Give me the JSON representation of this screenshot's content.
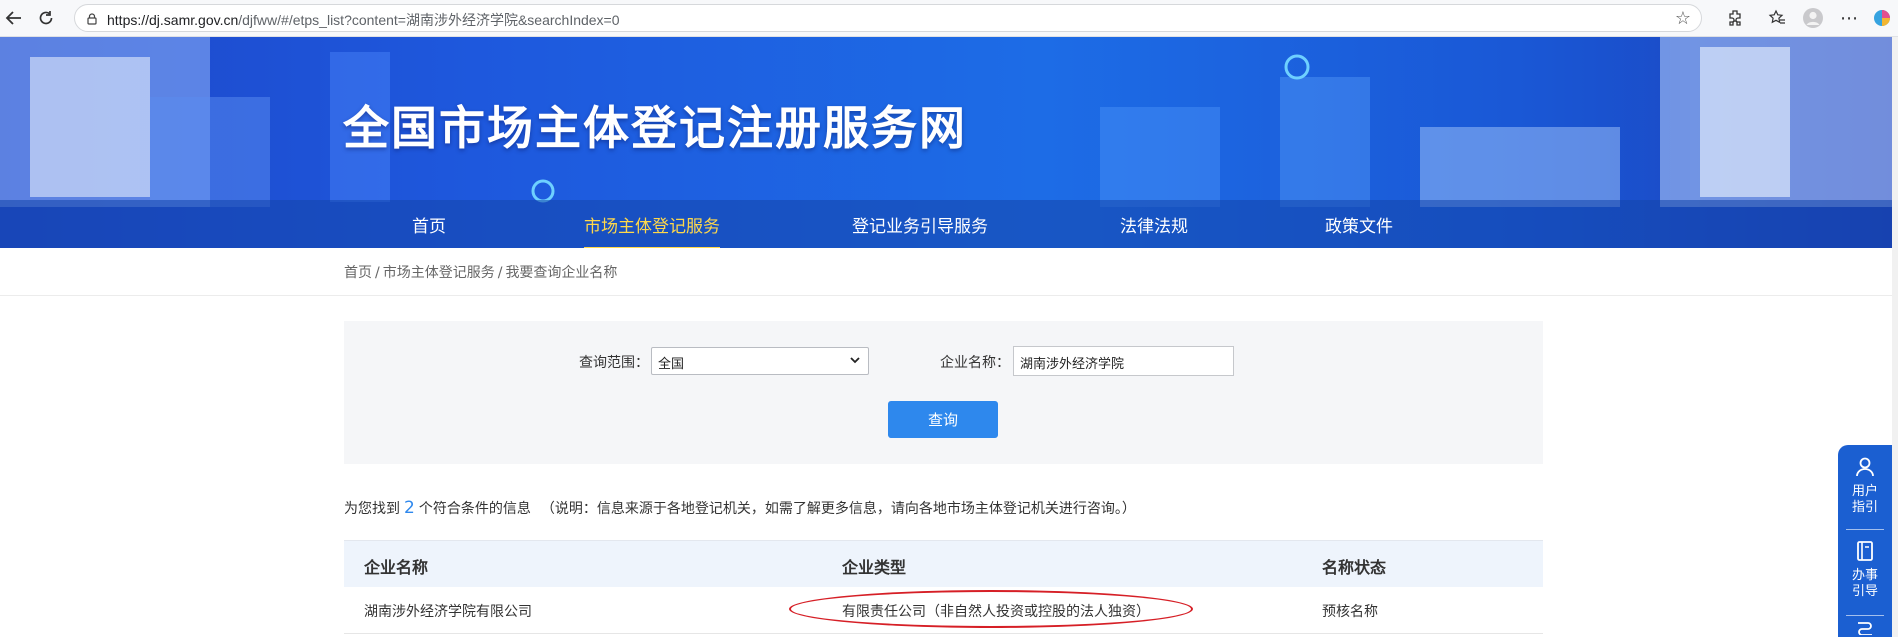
{
  "browser": {
    "url_host": "https://dj.samr.gov.cn",
    "url_path": "/djfww/#/etps_list?content=湖南涉外经济学院&searchIndex=0"
  },
  "site": {
    "title": "全国市场主体登记注册服务网"
  },
  "nav": {
    "items": [
      {
        "label": "首页"
      },
      {
        "label": "市场主体登记服务"
      },
      {
        "label": "登记业务引导服务"
      },
      {
        "label": "法律法规"
      },
      {
        "label": "政策文件"
      }
    ],
    "active_index": 1
  },
  "breadcrumb": {
    "items": [
      "首页",
      "市场主体登记服务",
      "我要查询企业名称"
    ],
    "separator": "/"
  },
  "search": {
    "scope_label": "查询范围：",
    "scope_value": "全国",
    "name_label": "企业名称：",
    "name_value": "湖南涉外经济学院",
    "button_label": "查询"
  },
  "result": {
    "prefix": "为您找到",
    "count": "2",
    "suffix": "个符合条件的信息",
    "note": "（说明：信息来源于各地登记机关，如需了解更多信息，请向各地市场主体登记机关进行咨询。）"
  },
  "table": {
    "headers": [
      "企业名称",
      "企业类型",
      "名称状态"
    ],
    "rows": [
      [
        "湖南涉外经济学院有限公司",
        "有限责任公司（非自然人投资或控股的法人独资）",
        "预核名称"
      ]
    ]
  },
  "float_panel": {
    "items": [
      {
        "line1": "用户",
        "line2": "指引",
        "icon": "user-icon"
      },
      {
        "line1": "办事",
        "line2": "引导",
        "icon": "book-icon"
      }
    ]
  },
  "colors": {
    "accent": "#2e88ed",
    "nav_active": "#ffd84a",
    "annotation": "#d61f26",
    "float_panel": "#1b5fd1"
  }
}
